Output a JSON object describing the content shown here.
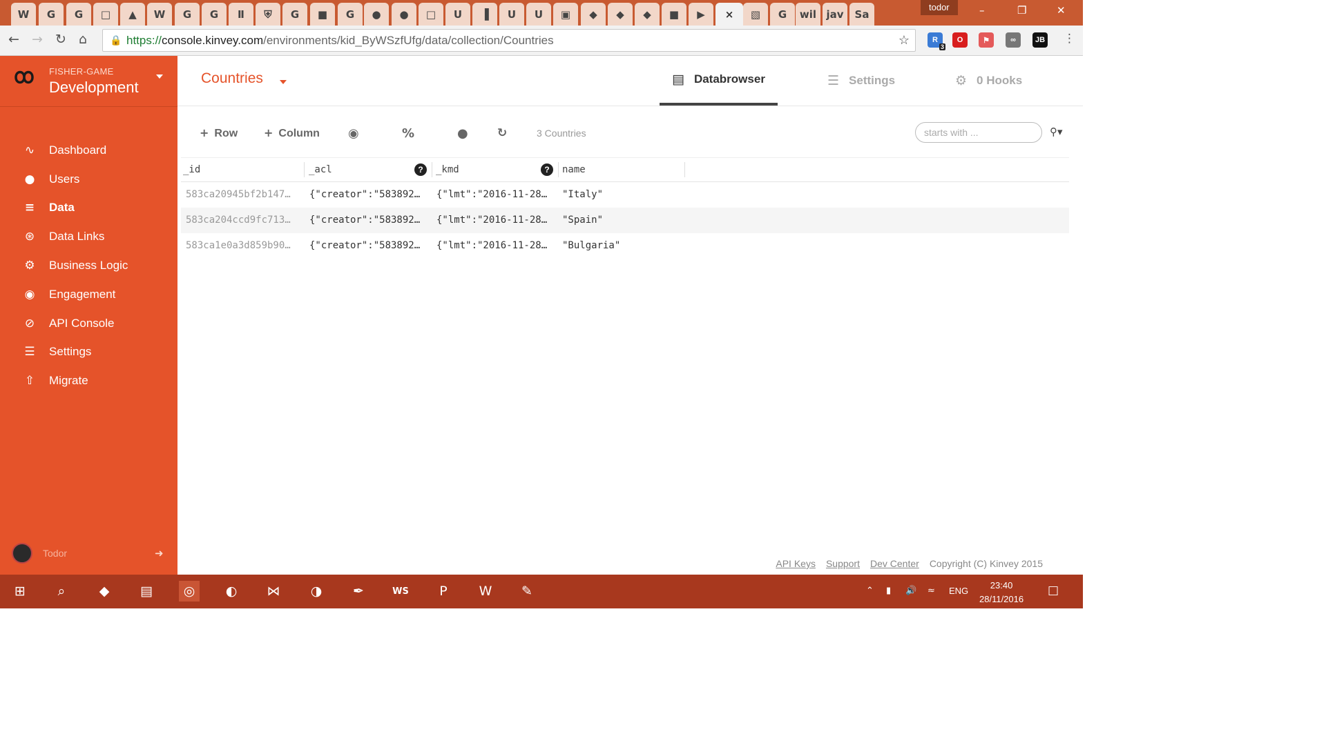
{
  "browser": {
    "tabs": [
      {
        "icon": "W",
        "bg": "#f2d7c9"
      },
      {
        "icon": "G",
        "bg": "#f2d7c9"
      },
      {
        "icon": "G",
        "bg": "#f2d7c9"
      },
      {
        "icon": "□",
        "bg": "#f2d7c9"
      },
      {
        "icon": "▲",
        "bg": "#f2d7c9"
      },
      {
        "icon": "W",
        "bg": "#f2d7c9"
      },
      {
        "icon": "G",
        "bg": "#f2d7c9"
      },
      {
        "icon": "G",
        "bg": "#f2d7c9"
      },
      {
        "icon": "Ⅱ",
        "bg": "#f2d7c9"
      },
      {
        "icon": "⛨",
        "bg": "#f2d7c9"
      },
      {
        "icon": "G",
        "bg": "#f2d7c9"
      },
      {
        "icon": "■",
        "bg": "#f2d7c9"
      },
      {
        "icon": "G",
        "bg": "#f2d7c9"
      },
      {
        "icon": "●",
        "bg": "#f2d7c9"
      },
      {
        "icon": "●",
        "bg": "#f2d7c9"
      },
      {
        "icon": "□",
        "bg": "#f2d7c9"
      },
      {
        "icon": "U",
        "bg": "#f2d7c9"
      },
      {
        "icon": "▐",
        "bg": "#f2d7c9"
      },
      {
        "icon": "U",
        "bg": "#f2d7c9"
      },
      {
        "icon": "U",
        "bg": "#f2d7c9"
      },
      {
        "icon": "▣",
        "bg": "#f2d7c9"
      },
      {
        "icon": "◆",
        "bg": "#f2d7c9"
      },
      {
        "icon": "◆",
        "bg": "#f2d7c9"
      },
      {
        "icon": "◆",
        "bg": "#f2d7c9"
      },
      {
        "icon": "■",
        "bg": "#f2d7c9"
      },
      {
        "icon": "▶",
        "bg": "#f2d7c9"
      },
      {
        "icon": "×",
        "bg": "#f2f2f2"
      },
      {
        "icon": "▧",
        "bg": "#f2d7c9"
      },
      {
        "icon": "G",
        "bg": "#f2d7c9"
      },
      {
        "icon": "wil",
        "bg": "#f2d7c9"
      },
      {
        "icon": "jav",
        "bg": "#f2d7c9"
      },
      {
        "icon": "Sa",
        "bg": "#f2d7c9"
      }
    ],
    "profile_name": "todor",
    "url_scheme": "https://",
    "url_host": "console.kinvey.com",
    "url_path": "/environments/kid_ByWSzfUfg/data/collection/Countries",
    "extensions": [
      {
        "label": "R",
        "color": "#3a7bd5",
        "badge": "3"
      },
      {
        "label": "O",
        "color": "#d81e1e",
        "badge": ""
      },
      {
        "label": "⚑",
        "color": "#e45a5a",
        "badge": ""
      },
      {
        "label": "∞",
        "color": "#777",
        "badge": ""
      },
      {
        "label": "JB",
        "color": "#111",
        "badge": ""
      }
    ]
  },
  "sidebar": {
    "org_name": "FISHER-GAME",
    "env_name": "Development",
    "items": [
      {
        "label": "Dashboard",
        "icon": "∿",
        "active": false
      },
      {
        "label": "Users",
        "icon": "●",
        "active": false
      },
      {
        "label": "Data",
        "icon": "≡",
        "active": true
      },
      {
        "label": "Data Links",
        "icon": "⊛",
        "active": false
      },
      {
        "label": "Business Logic",
        "icon": "⚙",
        "active": false
      },
      {
        "label": "Engagement",
        "icon": "◉",
        "active": false
      },
      {
        "label": "API Console",
        "icon": "⊘",
        "active": false
      },
      {
        "label": "Settings",
        "icon": "☰",
        "active": false
      },
      {
        "label": "Migrate",
        "icon": "⇧",
        "active": false
      }
    ],
    "user_name": "Todor"
  },
  "main": {
    "collection_name": "Countries",
    "tabs": [
      {
        "label": "Databrowser",
        "icon": "▤",
        "active": true
      },
      {
        "label": "Settings",
        "icon": "☰",
        "active": false
      },
      {
        "label": "0 Hooks",
        "icon": "⚙",
        "active": false
      }
    ],
    "toolbar": {
      "add_row_label": "Row",
      "add_column_label": "Column",
      "count_text": "3 Countries",
      "search_placeholder": "starts with ..."
    },
    "columns": [
      "_id",
      "_acl",
      "_kmd",
      "name"
    ],
    "rows": [
      {
        "_id": "583ca20945bf2b147…",
        "_acl": "{\"creator\":\"583892…",
        "_kmd": "{\"lmt\":\"2016-11-28…",
        "name": "\"Italy\""
      },
      {
        "_id": "583ca204ccd9fc713…",
        "_acl": "{\"creator\":\"583892…",
        "_kmd": "{\"lmt\":\"2016-11-28…",
        "name": "\"Spain\""
      },
      {
        "_id": "583ca1e0a3d859b90…",
        "_acl": "{\"creator\":\"583892…",
        "_kmd": "{\"lmt\":\"2016-11-28…",
        "name": "\"Bulgaria\""
      }
    ],
    "footer": {
      "links": [
        "API Keys",
        "Support",
        "Dev Center"
      ],
      "copyright": "Copyright (C) Kinvey 2015"
    }
  },
  "taskbar": {
    "apps": [
      {
        "name": "start",
        "icon": "⊞"
      },
      {
        "name": "search",
        "icon": "⌕"
      },
      {
        "name": "app-shield",
        "icon": "◆"
      },
      {
        "name": "file-explorer",
        "icon": "▤"
      },
      {
        "name": "chrome",
        "icon": "◎"
      },
      {
        "name": "firefox",
        "icon": "◐"
      },
      {
        "name": "visual-studio",
        "icon": "⋈"
      },
      {
        "name": "thunderbird",
        "icon": "◑"
      },
      {
        "name": "app-feather",
        "icon": "✒"
      },
      {
        "name": "webstorm",
        "icon": "WS"
      },
      {
        "name": "powerpoint",
        "icon": "P"
      },
      {
        "name": "word",
        "icon": "W"
      },
      {
        "name": "notepad-plus",
        "icon": "✎"
      }
    ],
    "language": "ENG",
    "time": "23:40",
    "date": "28/11/2016"
  },
  "colors": {
    "accent": "#e5532a",
    "titlebar": "#c85a31",
    "taskbar": "#a8381e"
  }
}
